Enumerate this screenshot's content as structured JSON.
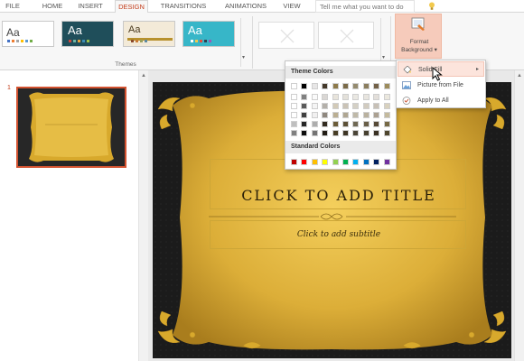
{
  "tabs": [
    "FILE",
    "HOME",
    "INSERT",
    "DESIGN",
    "TRANSITIONS",
    "ANIMATIONS",
    "VIEW"
  ],
  "active_tab": "DESIGN",
  "tell_me": {
    "placeholder": "Tell me what you want to do"
  },
  "ribbon": {
    "themes_group_label": "Themes",
    "themes": [
      {
        "label": "Aa",
        "bg": "#ffffff",
        "fg": "#444444"
      },
      {
        "label": "Aa",
        "bg": "#1f4e5a",
        "fg": "#ffffff"
      },
      {
        "label": "Aa",
        "bg": "#f3ead8",
        "fg": "#4a3a1e"
      },
      {
        "label": "Aa",
        "bg": "#37b6c8",
        "fg": "#ffffff"
      }
    ],
    "format_background": {
      "line1": "Format",
      "line2": "Background ▾"
    }
  },
  "slide_panel": {
    "slide_number": "1"
  },
  "slide": {
    "title_placeholder": "CLICK TO ADD TITLE",
    "subtitle_placeholder": "Click to add subtitle"
  },
  "palette": {
    "theme_colors_label": "Theme Colors",
    "standard_colors_label": "Standard Colors",
    "standard_colors": [
      "#c00000",
      "#ff0000",
      "#ffc000",
      "#ffff00",
      "#92d050",
      "#00b050",
      "#00b0f0",
      "#0070c0",
      "#002060",
      "#7030a0"
    ],
    "theme_columns": [
      "#ffffff",
      "#000000",
      "#e7e6e6",
      "#44392a",
      "#8e7a4a",
      "#7a6a48",
      "#948a6e",
      "#8b7d5e",
      "#736148",
      "#9d8c5c"
    ]
  },
  "fill_menu": {
    "items": [
      "Solid Fill",
      "Picture from File",
      "Apply to All"
    ]
  },
  "colors": {
    "accent": "#c43e1c",
    "gold": "#d8a92c"
  }
}
